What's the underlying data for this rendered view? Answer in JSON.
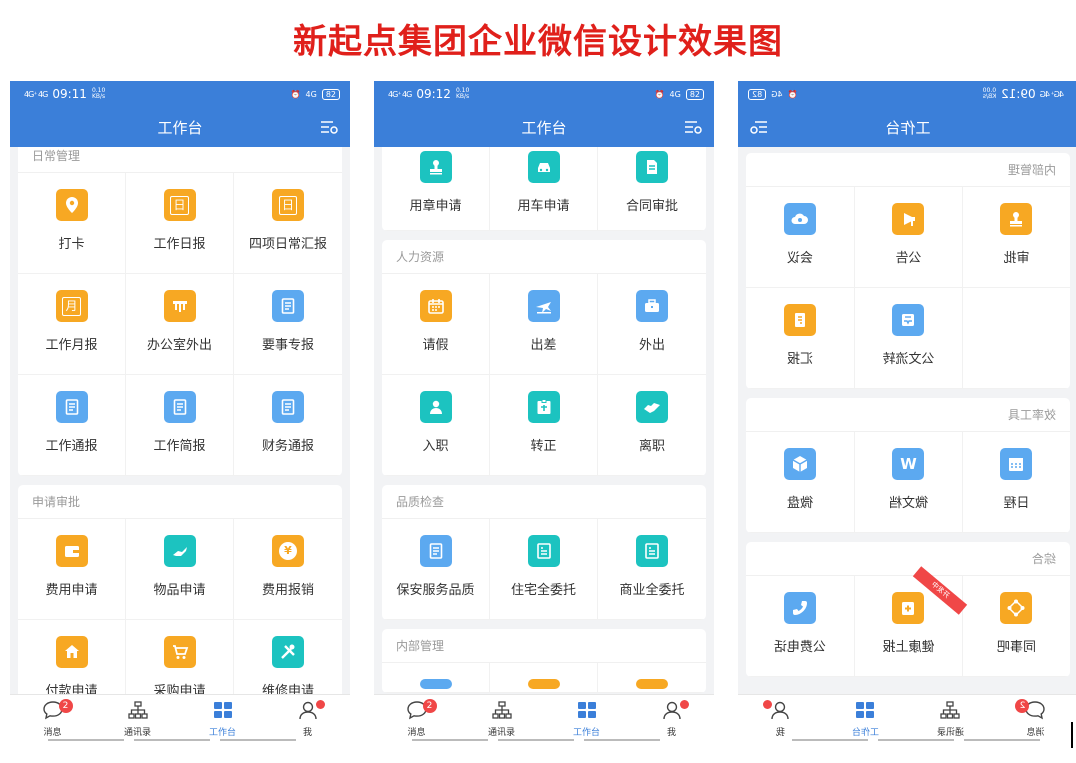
{
  "page_title": "新起点集团企业微信设计效果图",
  "colors": {
    "brand": "#3b7fd9",
    "orange": "#f7a823",
    "blue": "#5ca9f0",
    "teal": "#1cc3c0",
    "badge": "#f04747"
  },
  "phone1": {
    "status": {
      "signal": "4G⁺ 4G",
      "time": "09:11",
      "speed": "0.10",
      "speed_unit": "KB/s",
      "net": "4G",
      "battery": "82"
    },
    "nav_title": "工作台",
    "sections": [
      {
        "title": "日常管理",
        "items": [
          {
            "label": "打卡",
            "icon": "location-pin-icon",
            "color": "orange",
            "glyph": ""
          },
          {
            "label": "工作日报",
            "icon": "calendar-day-icon",
            "color": "orange",
            "glyph": "日"
          },
          {
            "label": "四项日常汇报",
            "icon": "calendar-day-icon",
            "color": "orange",
            "glyph": "日"
          },
          {
            "label": "工作月报",
            "icon": "calendar-month-icon",
            "color": "orange",
            "glyph": "月"
          },
          {
            "label": "办公室外出",
            "icon": "briefcase-icon",
            "color": "orange",
            "glyph": ""
          },
          {
            "label": "要事专报",
            "icon": "document-icon",
            "color": "blue",
            "glyph": ""
          },
          {
            "label": "工作通报",
            "icon": "document-icon",
            "color": "blue",
            "glyph": ""
          },
          {
            "label": "工作简报",
            "icon": "document-icon",
            "color": "blue",
            "glyph": ""
          },
          {
            "label": "财务通报",
            "icon": "document-icon",
            "color": "blue",
            "glyph": ""
          }
        ]
      },
      {
        "title": "申请审批",
        "items": [
          {
            "label": "费用申请",
            "icon": "wallet-icon",
            "color": "orange",
            "glyph": ""
          },
          {
            "label": "物品申请",
            "icon": "hand-icon",
            "color": "teal",
            "glyph": ""
          },
          {
            "label": "费用报销",
            "icon": "yen-coin-icon",
            "color": "orange",
            "glyph": "¥"
          },
          {
            "label": "付款申请",
            "icon": "house-icon",
            "color": "orange",
            "glyph": ""
          },
          {
            "label": "采购申请",
            "icon": "cart-icon",
            "color": "orange",
            "glyph": ""
          },
          {
            "label": "维修申请",
            "icon": "tools-icon",
            "color": "teal",
            "glyph": ""
          }
        ]
      }
    ],
    "tabs": [
      {
        "label": "消息",
        "icon": "chat-icon",
        "badge": "2"
      },
      {
        "label": "通讯录",
        "icon": "org-chart-icon",
        "badge": ""
      },
      {
        "label": "工作台",
        "icon": "grid-icon",
        "badge": ""
      },
      {
        "label": "我",
        "icon": "user-icon",
        "badge": "dot"
      }
    ]
  },
  "phone2": {
    "status": {
      "signal": "4G⁺ 4G",
      "time": "09:12",
      "speed": "0.10",
      "speed_unit": "KB/s",
      "net": "4G",
      "battery": "82"
    },
    "nav_title": "工作台",
    "top_items": [
      {
        "label": "用章申请",
        "icon": "stamp-icon",
        "color": "teal"
      },
      {
        "label": "用车申请",
        "icon": "car-icon",
        "color": "teal"
      },
      {
        "label": "合同审批",
        "icon": "contract-icon",
        "color": "teal"
      }
    ],
    "sections": [
      {
        "title": "人力资源",
        "items": [
          {
            "label": "请假",
            "icon": "calendar-icon",
            "color": "orange"
          },
          {
            "label": "出差",
            "icon": "plane-icon",
            "color": "blue"
          },
          {
            "label": "外出",
            "icon": "bag-icon",
            "color": "blue"
          },
          {
            "label": "入职",
            "icon": "person-icon",
            "color": "teal"
          },
          {
            "label": "转正",
            "icon": "id-badge-icon",
            "color": "teal"
          },
          {
            "label": "离职",
            "icon": "handshake-icon",
            "color": "teal"
          }
        ]
      },
      {
        "title": "品质检查",
        "items": [
          {
            "label": "保安服务品质",
            "icon": "document-icon",
            "color": "blue"
          },
          {
            "label": "住宅全委托",
            "icon": "list-doc-icon",
            "color": "teal"
          },
          {
            "label": "商业全委托",
            "icon": "list-doc-icon",
            "color": "teal"
          }
        ]
      },
      {
        "title": "内部管理",
        "items": []
      }
    ],
    "tabs": [
      {
        "label": "消息",
        "icon": "chat-icon",
        "badge": "2"
      },
      {
        "label": "通讯录",
        "icon": "org-chart-icon",
        "badge": ""
      },
      {
        "label": "工作台",
        "icon": "grid-icon",
        "badge": ""
      },
      {
        "label": "我",
        "icon": "user-icon",
        "badge": "dot"
      }
    ]
  },
  "phone3": {
    "status": {
      "signal": "4G⁺ 4G",
      "time": "09:12",
      "speed": "0.00",
      "speed_unit": "KB/s",
      "net": "4G",
      "battery": "82"
    },
    "nav_title": "工作台",
    "sections": [
      {
        "title": "内部管理",
        "items": [
          {
            "label": "审批",
            "icon": "stamp-icon",
            "color": "orange"
          },
          {
            "label": "公告",
            "icon": "megaphone-icon",
            "color": "orange"
          },
          {
            "label": "会议",
            "icon": "cloud-icon",
            "color": "blue"
          },
          {
            "label": "",
            "icon": "",
            "color": ""
          },
          {
            "label": "公文流转",
            "icon": "inbox-icon",
            "color": "blue"
          },
          {
            "label": "汇报",
            "icon": "report-icon",
            "color": "orange"
          }
        ]
      },
      {
        "title": "效率工具",
        "items": [
          {
            "label": "日程",
            "icon": "schedule-icon",
            "color": "blue"
          },
          {
            "label": "微文档",
            "icon": "w-doc-icon",
            "color": "blue",
            "glyph": "W"
          },
          {
            "label": "微盘",
            "icon": "cube-icon",
            "color": "blue"
          }
        ]
      },
      {
        "title": "综合",
        "items": [
          {
            "label": "同事吧",
            "icon": "network-icon",
            "color": "orange"
          },
          {
            "label": "健康上报",
            "icon": "medical-icon",
            "color": "orange",
            "ribbon": "开发中"
          },
          {
            "label": "公费电话",
            "icon": "phone-icon",
            "color": "blue"
          }
        ]
      }
    ],
    "tabs": [
      {
        "label": "消息",
        "icon": "chat-icon",
        "badge": "2"
      },
      {
        "label": "通讯录",
        "icon": "org-chart-icon",
        "badge": ""
      },
      {
        "label": "工作台",
        "icon": "grid-icon",
        "badge": ""
      },
      {
        "label": "我",
        "icon": "user-icon",
        "badge": "dot"
      }
    ]
  }
}
